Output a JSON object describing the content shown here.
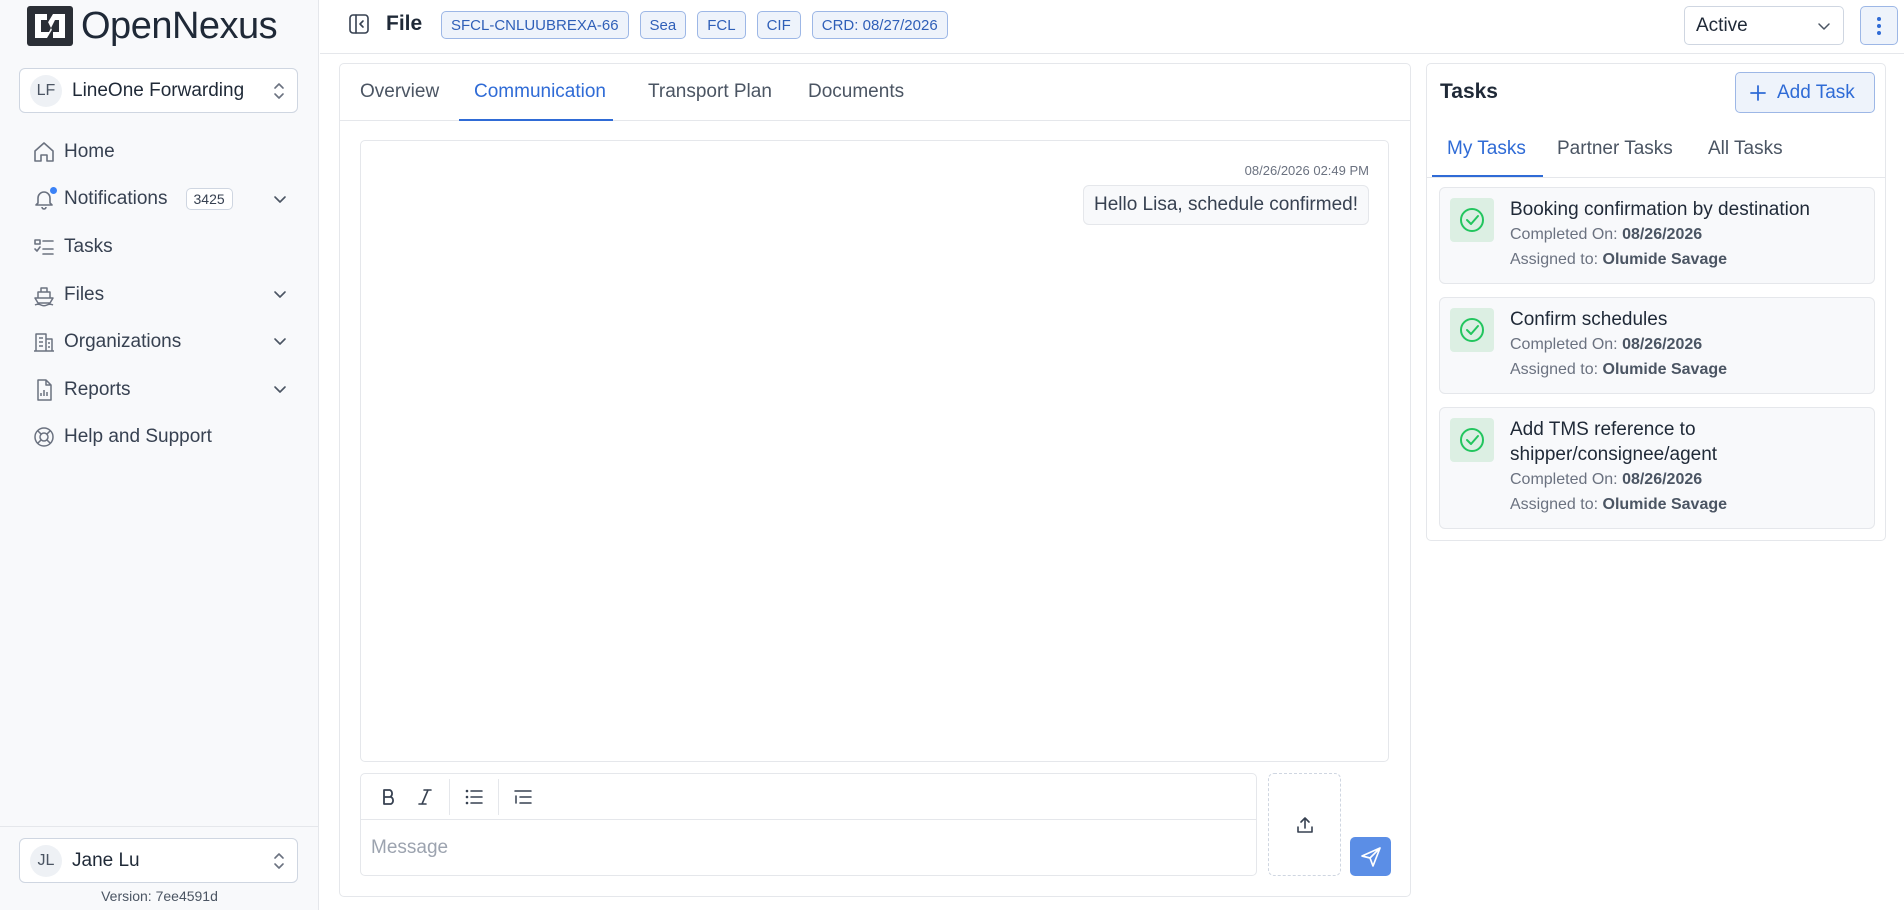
{
  "brand": {
    "logo_open": "Open",
    "logo_nexus": "Nexus"
  },
  "org": {
    "initials": "LF",
    "name": "LineOne Forwarding"
  },
  "nav": {
    "home": "Home",
    "notifications": "Notifications",
    "notifications_count": "3425",
    "tasks": "Tasks",
    "files": "Files",
    "organizations": "Organizations",
    "reports": "Reports",
    "help": "Help and Support"
  },
  "user": {
    "initials": "JL",
    "name": "Jane Lu"
  },
  "version": "Version: 7ee4591d",
  "header": {
    "title": "File",
    "tags": [
      "SFCL-CNLUUBREXA-66",
      "Sea",
      "FCL",
      "CIF",
      "CRD: 08/27/2026"
    ],
    "status": "Active"
  },
  "main_tabs": [
    "Overview",
    "Communication",
    "Transport Plan",
    "Documents"
  ],
  "chat": {
    "message_time": "08/26/2026 02:49 PM",
    "message_text": "Hello Lisa, schedule confirmed!",
    "input_placeholder": "Message"
  },
  "tasks_panel": {
    "title": "Tasks",
    "add_label": "Add Task",
    "tabs": [
      "My Tasks",
      "Partner Tasks",
      "All Tasks"
    ],
    "completed_label": "Completed On:",
    "assigned_label": "Assigned to:",
    "items": [
      {
        "title": "Booking confirmation by destination",
        "completed_on": "08/26/2026",
        "assigned_to": "Olumide Savage"
      },
      {
        "title": "Confirm schedules",
        "completed_on": "08/26/2026",
        "assigned_to": "Olumide Savage"
      },
      {
        "title": "Add TMS reference to shipper/consignee/agent",
        "completed_on": "08/26/2026",
        "assigned_to": "Olumide Savage"
      }
    ]
  },
  "colors": {
    "accent": "#2f6bd6",
    "send": "#5b8ee6",
    "success": "#22c55e"
  }
}
